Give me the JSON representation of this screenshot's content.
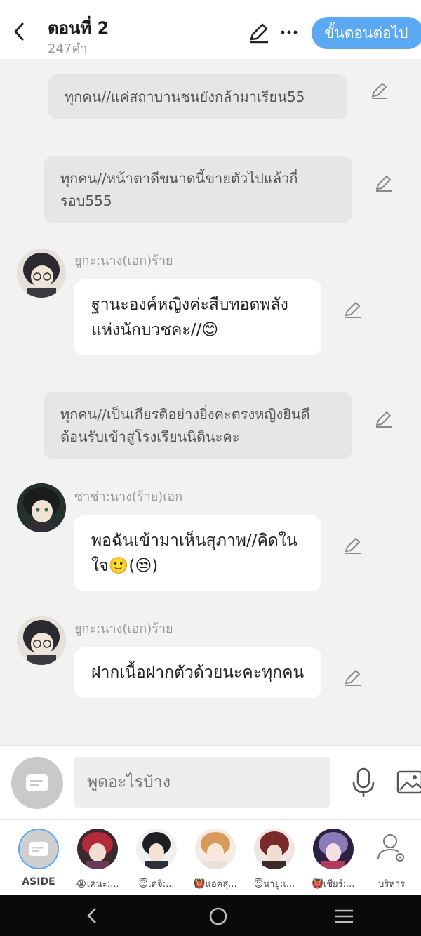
{
  "header": {
    "title": "ตอนที่ 2",
    "subtitle": "247คำ",
    "next_label": "ขั้นตอนต่อไป"
  },
  "messages": [
    {
      "type": "narration",
      "text": "ทุกคน//แค่สถาบานชนยังกล้ามาเรียน55"
    },
    {
      "type": "narration",
      "text": "ทุกคน//หน้าตาดีขนาดนี้ขายตัวไปแล้วกี่รอบ555"
    },
    {
      "type": "dialogue",
      "speaker": "ยูกะ:นาง(เอก)ร้าย",
      "text": "ฐานะองค์หญิงค่ะสืบทอดพลังแห่งนักบวชคะ//😊"
    },
    {
      "type": "narration",
      "text": "ทุกคน//เป็นเกียรติอย่างยิ่งค่ะตรงหญิงยินดีต้อนรับเข้าสู่โรงเรียนนิตินะคะ"
    },
    {
      "type": "dialogue",
      "speaker": "ซาช่า:นาง(ร้าย)เอก",
      "text": "พอฉันเข้ามาเห็นสุภาพ//คิดในใจ🙂(😒)"
    },
    {
      "type": "dialogue",
      "speaker": "ยูกะ:นาง(เอก)ร้าย",
      "text": "ฝากเนื้อฝากตัวด้วยนะคะทุกคน"
    }
  ],
  "input": {
    "placeholder": "พูดอะไรบ้าง"
  },
  "characters": [
    {
      "label": "ASIDE"
    },
    {
      "label": "😭เคนะ:..."
    },
    {
      "label": "😇เคจิ:..."
    },
    {
      "label": "👹แอคสุ..."
    },
    {
      "label": "😇นายู:เ..."
    },
    {
      "label": "👹เชียร์:..."
    },
    {
      "label": "บริหาร"
    }
  ],
  "colors": {
    "accent": "#5aa9f2",
    "background": "#f2f2f2",
    "narration_bg": "#e6e6e6",
    "bubble_bg": "#ffffff"
  }
}
